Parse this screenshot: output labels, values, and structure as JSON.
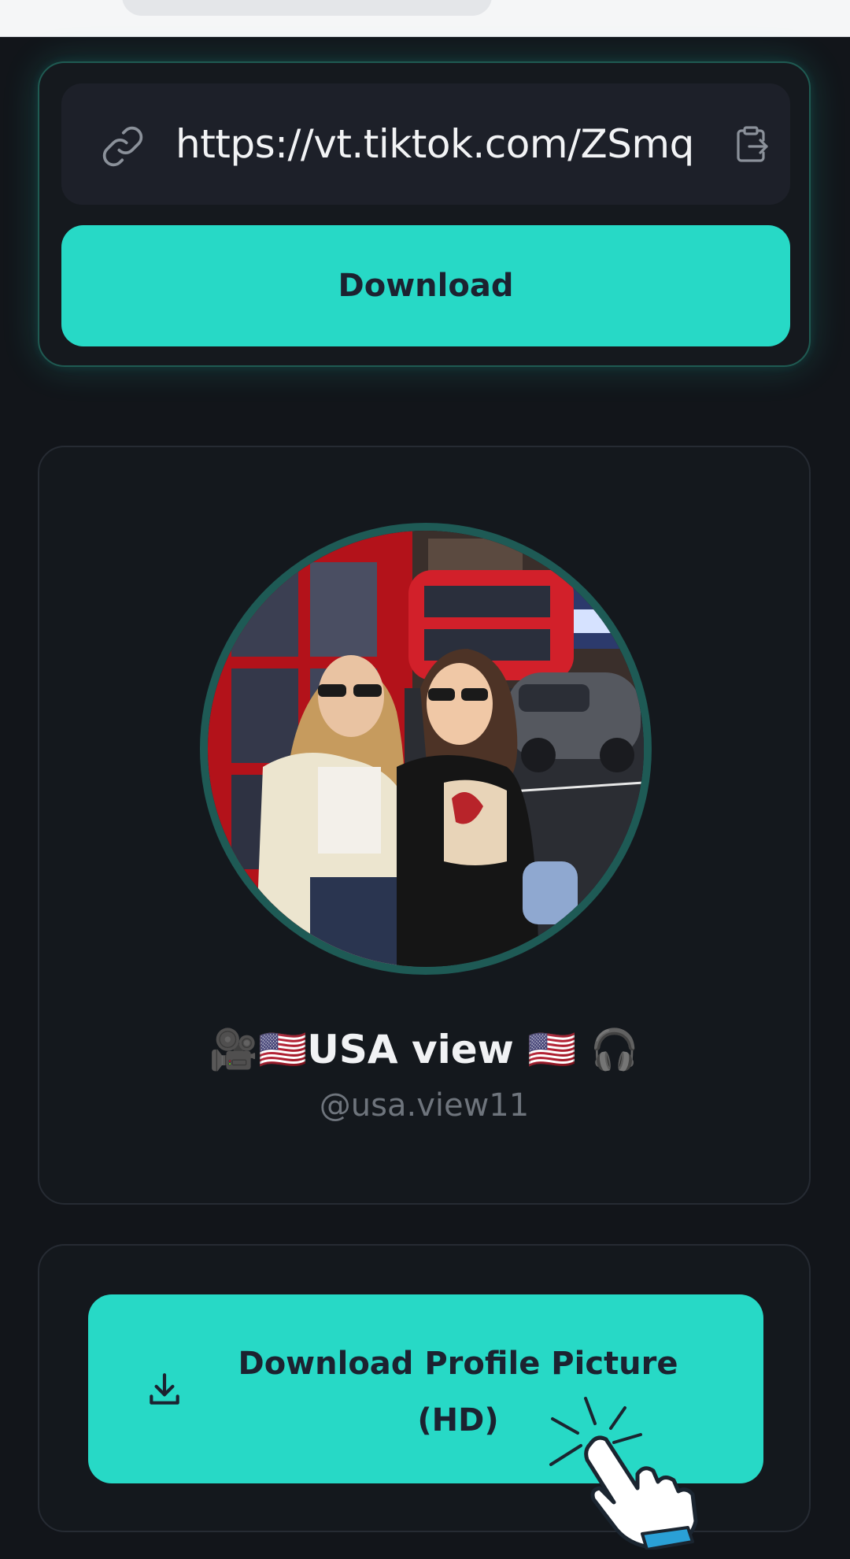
{
  "url_input": {
    "value": "https://vt.tiktok.com/ZSmq",
    "left_icon": "link-icon",
    "right_icon": "paste-clipboard-icon"
  },
  "download_button": {
    "label": "Download"
  },
  "profile": {
    "name": "🎥🇺🇸USA view 🇺🇸 🎧",
    "handle": "@usa.view11",
    "avatar_alt": "profile-photo"
  },
  "hd_button": {
    "label": "Download Profile Picture (HD)",
    "icon": "download-icon"
  },
  "colors": {
    "accent": "#27d9c6",
    "background": "#12151a",
    "card": "#14181d",
    "button_text": "#1c2230",
    "handle_text": "#6e747c"
  }
}
